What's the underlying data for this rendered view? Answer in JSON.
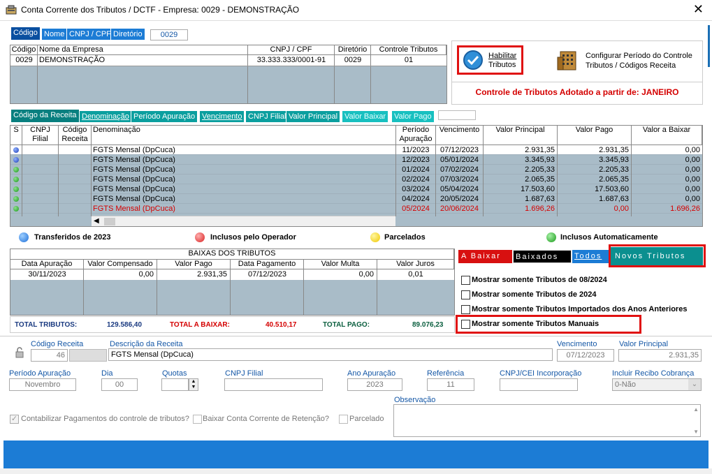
{
  "window": {
    "title": "Conta Corrente dos Tributos / DCTF   -   Empresa: 0029 - DEMONSTRAÇÃO",
    "close": "✕"
  },
  "company_tabs": [
    "Código",
    "Nome",
    "CNPJ / CPF",
    "Diretório"
  ],
  "company_search_value": "0029",
  "company_grid": {
    "headers": [
      "Código",
      "Nome da Empresa",
      "CNPJ / CPF",
      "Diretório",
      "Controle Tributos"
    ],
    "row": [
      "0029",
      "DEMONSTRAÇÃO",
      "33.333.333/0001-91",
      "0029",
      "01"
    ]
  },
  "habilitar_label_1": "Habilitar",
  "habilitar_label_2": "Tributos",
  "configurar_label_1": "Configurar Período do Controle",
  "configurar_label_2": "Tributos / Códigos Receita",
  "controle_msg": "Controle de Tributos Adotado a partir de: JANEIRO",
  "receita_tabs": [
    "Código da Receita",
    "Denominação",
    "Período Apuração",
    "Vencimento",
    "CNPJ Filial",
    "Valor Principal",
    "Valor Baixar",
    "Valor Pago"
  ],
  "main_grid": {
    "headers": {
      "s": "S",
      "cnpj1": "CNPJ",
      "cnpj2": "Filial",
      "cod1": "Código",
      "cod2": "Receita",
      "den": "Denominação",
      "per1": "Período",
      "per2": "Apuração",
      "venc": "Vencimento",
      "vprin": "Valor Principal",
      "vpago": "Valor Pago",
      "vbaixar": "Valor a Baixar"
    },
    "rows": [
      {
        "status": "blue",
        "den": "FGTS Mensal (DpCuca)",
        "per": "11/2023",
        "venc": "07/12/2023",
        "vprin": "2.931,35",
        "vpago": "2.931,35",
        "vbaixar": "0,00",
        "red": false
      },
      {
        "status": "blue",
        "den": "FGTS Mensal (DpCuca)",
        "per": "12/2023",
        "venc": "05/01/2024",
        "vprin": "3.345,93",
        "vpago": "3.345,93",
        "vbaixar": "0,00",
        "red": false
      },
      {
        "status": "green",
        "den": "FGTS Mensal (DpCuca)",
        "per": "01/2024",
        "venc": "07/02/2024",
        "vprin": "2.205,33",
        "vpago": "2.205,33",
        "vbaixar": "0,00",
        "red": false
      },
      {
        "status": "green",
        "den": "FGTS Mensal (DpCuca)",
        "per": "02/2024",
        "venc": "07/03/2024",
        "vprin": "2.065,35",
        "vpago": "2.065,35",
        "vbaixar": "0,00",
        "red": false
      },
      {
        "status": "green",
        "den": "FGTS Mensal (DpCuca)",
        "per": "03/2024",
        "venc": "05/04/2024",
        "vprin": "17.503,60",
        "vpago": "17.503,60",
        "vbaixar": "0,00",
        "red": false
      },
      {
        "status": "green",
        "den": "FGTS Mensal (DpCuca)",
        "per": "04/2024",
        "venc": "20/05/2024",
        "vprin": "1.687,63",
        "vpago": "1.687,63",
        "vbaixar": "0,00",
        "red": false
      },
      {
        "status": "green",
        "den": "FGTS Mensal (DpCuca)",
        "per": "05/2024",
        "venc": "20/06/2024",
        "vprin": "1.696,26",
        "vpago": "0,00",
        "vbaixar": "1.696,26",
        "red": true
      }
    ]
  },
  "legend": [
    {
      "label": "Transferidos de 2023",
      "color": "#1e6fd9"
    },
    {
      "label": "Inclusos pelo Operador",
      "color": "#d92020"
    },
    {
      "label": "Parcelados",
      "color": "#f0c800"
    },
    {
      "label": "Inclusos Automaticamente",
      "color": "#1a9a1a"
    }
  ],
  "baixas": {
    "title": "BAIXAS DOS TRIBUTOS",
    "headers": [
      "Data Apuração",
      "Valor Compensado",
      "Valor Pago",
      "Data Pagamento",
      "Valor Multa",
      "Valor Juros"
    ],
    "row": [
      "30/11/2023",
      "0,00",
      "2.931,35",
      "07/12/2023",
      "0,00",
      "0,01"
    ]
  },
  "totals": {
    "tributos_label": "TOTAL TRIBUTOS:",
    "tributos": "129.586,40",
    "baixar_label": "TOTAL A BAIXAR:",
    "baixar": "40.510,17",
    "pago_label": "TOTAL PAGO:",
    "pago": "89.076,23"
  },
  "filter_tabs": [
    "A Baixar",
    "Baixados",
    "Todos",
    "Novos Tributos"
  ],
  "checks": [
    "Mostrar somente Tributos de 08/2024",
    "Mostrar somente Tributos de 2024",
    "Mostrar somente Tributos Importados dos Anos Anteriores",
    "Mostrar somente Tributos Manuais"
  ],
  "form": {
    "codigo_receita_label": "Código Receita",
    "codigo_receita": "46",
    "descricao_label": "Descrição da Receita",
    "descricao": "FGTS Mensal (DpCuca)",
    "vencimento_label": "Vencimento",
    "vencimento": "07/12/2023",
    "valor_principal_label": "Valor Principal",
    "valor_principal": "2.931,35",
    "periodo_label": "Período Apuração",
    "periodo": "Novembro",
    "dia_label": "Dia",
    "dia": "00",
    "quotas_label": "Quotas",
    "quotas": "",
    "cnpj_filial_label": "CNPJ Filial",
    "cnpj_filial": "",
    "ano_label": "Ano Apuração",
    "ano": "2023",
    "referencia_label": "Referência",
    "referencia": "11",
    "cnpj_cei_label": "CNPJ/CEI Incorporação",
    "cnpj_cei": "",
    "recibo_label": "Incluir Recibo Cobrança",
    "recibo": "0-Não",
    "obs_label": "Observação",
    "contabilizar_label": "Contabilizar Pagamentos do controle de tributos?",
    "baixar_cc_label": "Baixar Conta Corrente de Retenção?",
    "parcelado_label": "Parcelado"
  },
  "colors": {
    "accent": "#1c7cd5",
    "teal": "#0b9f9f",
    "grid_bg": "#a9bcc8",
    "red": "#d40000"
  }
}
